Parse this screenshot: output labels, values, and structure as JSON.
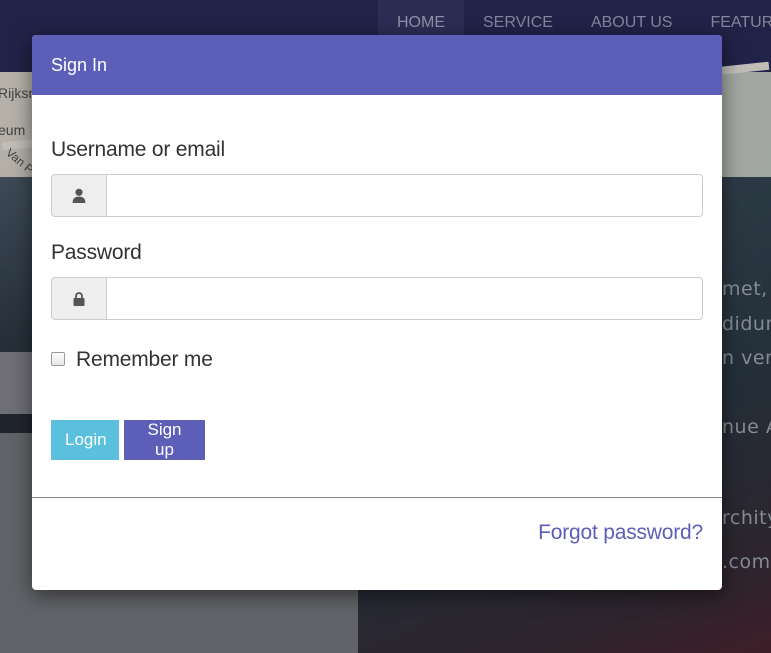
{
  "nav": {
    "items": [
      {
        "label": "HOME",
        "active": true
      },
      {
        "label": "SERVICE",
        "active": false
      },
      {
        "label": "ABOUT US",
        "active": false
      },
      {
        "label": "FEATURED S",
        "active": false
      }
    ]
  },
  "map": {
    "labels": [
      "Rijksn",
      "eum",
      "Van P"
    ]
  },
  "background_text": [
    "met, c",
    "didun",
    "n ven",
    "nue A",
    "rchity.",
    ".com"
  ],
  "modal": {
    "title": "Sign In",
    "username": {
      "label": "Username or email",
      "value": "",
      "placeholder": "",
      "icon": "user-icon"
    },
    "password": {
      "label": "Password",
      "value": "",
      "placeholder": "",
      "icon": "lock-icon"
    },
    "remember": {
      "label": "Remember me",
      "checked": false
    },
    "buttons": {
      "login": "Login",
      "signup": "Sign up"
    },
    "forgot_link": "Forgot password?"
  },
  "colors": {
    "header": "#5c5eb8",
    "login_button": "#5bc0de",
    "signup_button": "#5c5eb8",
    "link": "#5c5eb8",
    "nav_background": "#2b2c5c"
  }
}
